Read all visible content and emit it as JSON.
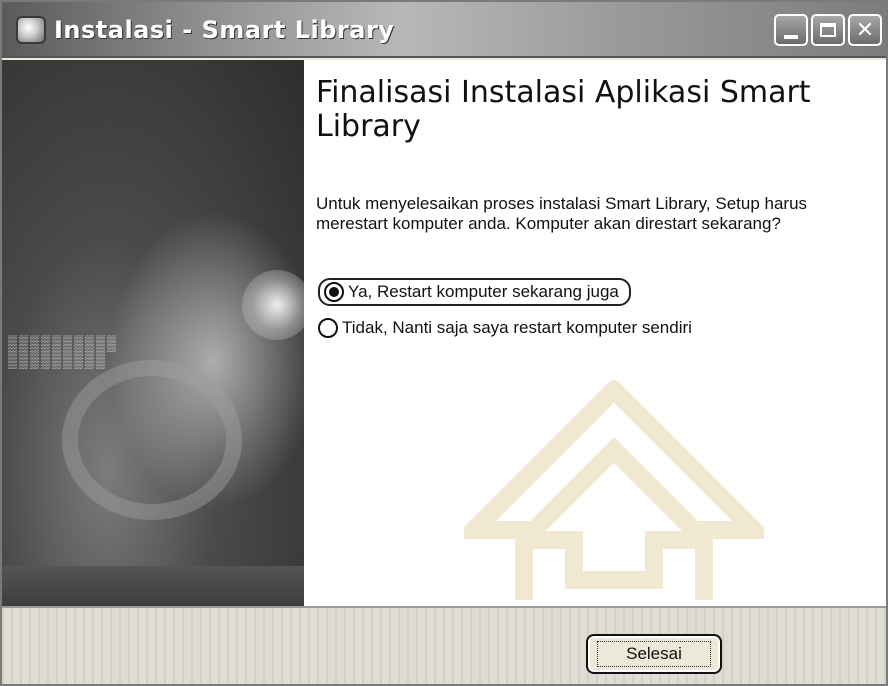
{
  "window": {
    "title": "Instalasi - Smart Library",
    "app_icon": "installer-icon",
    "controls": {
      "minimize": "minimize-icon",
      "maximize": "maximize-icon",
      "close": "close-icon"
    }
  },
  "main": {
    "heading": "Finalisasi Instalasi Aplikasi Smart Library",
    "description": "Untuk menyelesaikan proses instalasi Smart Library, Setup harus merestart komputer anda. Komputer akan direstart sekarang?",
    "options": [
      {
        "label": "Ya, Restart komputer sekarang juga",
        "selected": true
      },
      {
        "label": "Tidak, Nanti saja saya restart komputer sendiri",
        "selected": false
      }
    ]
  },
  "footer": {
    "finish_label": "Selesai"
  },
  "colors": {
    "window_frame": "#7a7a7a",
    "dialog_bg": "#ece9d8",
    "content_bg": "#ffffff",
    "title_text": "#ffffff"
  }
}
